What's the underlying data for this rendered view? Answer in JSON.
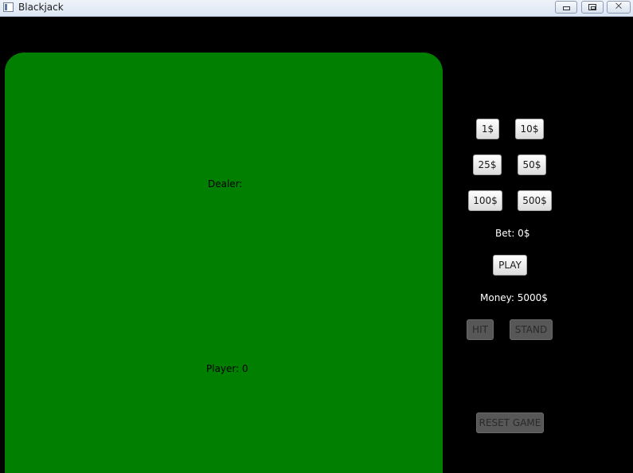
{
  "window": {
    "title": "Blackjack",
    "controls": {
      "minimize_icon": "minimize-icon",
      "maximize_icon": "restore-icon",
      "close_label": "⨉"
    }
  },
  "table": {
    "dealer_label": "Dealer:",
    "player_label": "Player: 0",
    "felt_color": "#007f00"
  },
  "chips": [
    {
      "label": "1$"
    },
    {
      "label": "10$"
    },
    {
      "label": "25$"
    },
    {
      "label": "50$"
    },
    {
      "label": "100$"
    },
    {
      "label": "500$"
    }
  ],
  "bet_text": "Bet: 0$",
  "play_label": "PLAY",
  "money_text": "Money: 5000$",
  "hit_label": "HIT",
  "stand_label": "STAND",
  "reset_label": "RESET GAME"
}
